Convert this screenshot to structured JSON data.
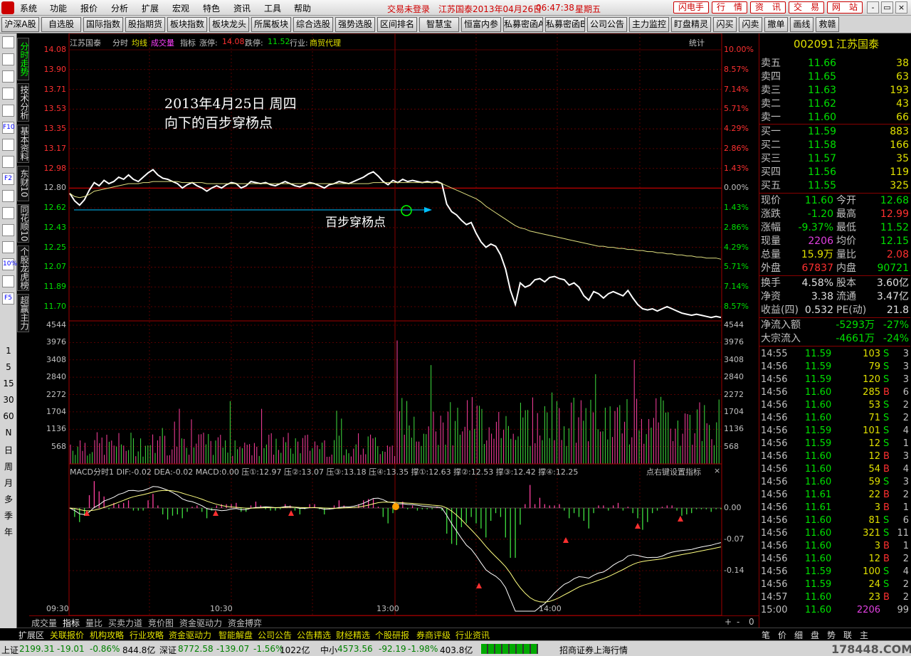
{
  "menu": {
    "items": [
      "系统",
      "功能",
      "报价",
      "分析",
      "扩展",
      "宏观",
      "特色",
      "资讯",
      "工具",
      "帮助"
    ],
    "status_login": "交易未登录",
    "status_stock": "江苏国泰2013年04月26日",
    "status_time": "06:47:38",
    "status_day": "星期五",
    "right_buttons": [
      "闪电手",
      "行　情",
      "资　讯",
      "交　易",
      "网　站"
    ],
    "window_buttons": [
      "-",
      "▭",
      "×"
    ]
  },
  "toolbar": {
    "items": [
      "沪深A股",
      "自选股",
      "国际指数",
      "股指期货",
      "板块指数",
      "板块龙头",
      "所属板块",
      "综合选股",
      "强势选股",
      "区间排名",
      "智慧宝",
      "恒富内参",
      "私募密函A",
      "私募密函B",
      "公司公告",
      "主力监控",
      "盯盘精灵",
      "闪买",
      "闪卖",
      "撤单",
      "画线",
      "救赣"
    ]
  },
  "sidebar": {
    "icons": [
      "list-icon",
      "grid-icon",
      "line-chart-icon",
      "candle-icon",
      "table-icon",
      "f10-icon",
      "report-icon",
      "news-icon",
      "f2-icon",
      "block-icon",
      "search-icon",
      "trend-icon",
      "bar-icon",
      "percent-icon",
      "pen-icon",
      "f5-icon"
    ],
    "icon_labels": [
      "",
      "",
      "",
      "",
      "",
      "F10",
      "",
      "",
      "F2",
      "",
      "",
      "",
      "",
      "10%",
      "",
      "F5"
    ],
    "periods": [
      "1",
      "5",
      "15",
      "30",
      "60",
      "N",
      "日",
      "周",
      "月",
      "多",
      "季",
      "年"
    ]
  },
  "vtabs": [
    "分时走势",
    "技术分析",
    "基本资料",
    "东财10",
    "同花顺10",
    "个股龙虎榜",
    "超赢主力"
  ],
  "chart_header": {
    "name": "江苏国泰",
    "mode": "分时",
    "avg": "均线",
    "vol": "成交量",
    "ind": "指标",
    "limit_up_label": "涨停:",
    "limit_up": "14.08",
    "limit_down_label": "跌停:",
    "limit_down": "11.52",
    "industry_label": "行业:",
    "industry": "商贸代理",
    "stats": "统计"
  },
  "annotations": {
    "date_line": "2013年4月25日  周四",
    "desc_line": "向下的百步穿杨点",
    "point_label": "百步穿杨点"
  },
  "macd_header": "MACD分时1  DIF:-0.02  DEA:-0.02  MACD:0.00  压①:12.97  压②:13.07  压③:13.18  压④:13.35  撑①:12.63  撑②:12.53  撑③:12.42  撑④:12.25",
  "macd_hint": "点右键设置指标",
  "chart_data": {
    "type": "line",
    "price_axis": {
      "labels": [
        "14.08",
        "13.90",
        "13.71",
        "13.53",
        "13.35",
        "13.17",
        "12.98",
        "12.80",
        "12.62",
        "12.43",
        "12.25",
        "12.07",
        "11.89",
        "11.70"
      ],
      "ylim": [
        11.7,
        14.08
      ],
      "prev_close": 12.8
    },
    "pct_axis": {
      "labels": [
        "10.00%",
        "8.57%",
        "7.14%",
        "5.71%",
        "4.29%",
        "2.86%",
        "1.43%",
        "0.00%",
        "1.43%",
        "2.86%",
        "4.29%",
        "5.71%",
        "7.14%",
        "8.57%"
      ]
    },
    "volume_axis": {
      "labels": [
        "4544",
        "3976",
        "3408",
        "2840",
        "2272",
        "1704",
        "1136",
        "568"
      ],
      "ylim": [
        0,
        4544
      ]
    },
    "macd_axis": {
      "labels": [
        "0.00",
        "-0.07",
        "-0.14"
      ],
      "ylim": [
        -0.21,
        0.07
      ]
    },
    "time_labels": [
      "09:30",
      "10:30",
      "13:00",
      "14:00"
    ],
    "series": [
      {
        "values": [
          12.75,
          12.68,
          12.64,
          12.69,
          12.78,
          12.85,
          12.82,
          12.87,
          12.84,
          12.86,
          12.9,
          12.88,
          12.92,
          12.88,
          12.86,
          12.9,
          12.94,
          12.97,
          12.92,
          12.89,
          12.88,
          12.86,
          12.84,
          12.8,
          12.83,
          12.85,
          12.82,
          12.8,
          12.77,
          12.8,
          12.82,
          12.8,
          12.83,
          12.85,
          12.84,
          12.8,
          12.82,
          12.86,
          12.85,
          12.84,
          12.85,
          12.83,
          12.82,
          12.84,
          12.86,
          12.84,
          12.82,
          12.81,
          12.83,
          12.85,
          12.84,
          12.82,
          12.8,
          12.83,
          12.84,
          12.86,
          12.85,
          12.84,
          12.86,
          12.88,
          12.9,
          12.93,
          12.95,
          12.91,
          12.86,
          12.83,
          12.87,
          12.85,
          12.88,
          12.86,
          12.87,
          12.86,
          12.85,
          12.86,
          12.85,
          12.86,
          12.84,
          12.65,
          12.58,
          12.55,
          12.5,
          12.46,
          12.48,
          12.38,
          12.3,
          12.25,
          12.28,
          12.26,
          12.18,
          12.05,
          11.85,
          11.72,
          11.92,
          11.88,
          11.9,
          11.95,
          11.96,
          11.93,
          11.97,
          11.98,
          11.96,
          11.95,
          11.9,
          11.92,
          11.88,
          11.8,
          11.76,
          11.84,
          11.82,
          11.78,
          11.82,
          11.84,
          11.82,
          11.8,
          11.85,
          11.78,
          11.72,
          11.68,
          11.67,
          11.68,
          11.66,
          11.68,
          11.7,
          11.68,
          11.66,
          11.64,
          11.63,
          11.62,
          11.63,
          11.62,
          11.61,
          11.6,
          11.61,
          11.6
        ]
      },
      {
        "values": [
          12.75,
          12.72,
          12.71,
          12.72,
          12.74,
          12.77,
          12.78,
          12.79,
          12.8,
          12.81,
          12.82,
          12.83,
          12.84,
          12.84,
          12.84,
          12.85,
          12.85,
          12.86,
          12.86,
          12.86,
          12.86,
          12.86,
          12.86,
          12.85,
          12.85,
          12.85,
          12.85,
          12.85,
          12.84,
          12.84,
          12.84,
          12.84,
          12.84,
          12.84,
          12.84,
          12.84,
          12.84,
          12.84,
          12.84,
          12.84,
          12.84,
          12.84,
          12.84,
          12.84,
          12.84,
          12.84,
          12.84,
          12.84,
          12.84,
          12.84,
          12.84,
          12.84,
          12.84,
          12.84,
          12.84,
          12.84,
          12.84,
          12.84,
          12.84,
          12.84,
          12.84,
          12.84,
          12.85,
          12.85,
          12.85,
          12.85,
          12.85,
          12.85,
          12.85,
          12.85,
          12.85,
          12.85,
          12.85,
          12.85,
          12.85,
          12.85,
          12.84,
          12.82,
          12.8,
          12.78,
          12.76,
          12.74,
          12.72,
          12.7,
          12.67,
          12.63,
          12.6,
          12.57,
          12.54,
          12.51,
          12.48,
          12.45,
          12.43,
          12.42,
          12.4,
          12.39,
          12.38,
          12.37,
          12.36,
          12.35,
          12.34,
          12.33,
          12.32,
          12.31,
          12.3,
          12.29,
          12.28,
          12.27,
          12.26,
          12.26,
          12.25,
          12.25,
          12.24,
          12.24,
          12.23,
          12.23,
          12.22,
          12.22,
          12.21,
          12.21,
          12.2,
          12.2,
          12.19,
          12.19,
          12.18,
          12.18,
          12.17,
          12.17,
          12.16,
          12.16,
          12.15,
          12.15,
          12.15,
          12.14
        ]
      }
    ]
  },
  "quote": {
    "code": "002091",
    "name": "江苏国泰",
    "sell": [
      {
        "label": "卖五",
        "price": "11.66",
        "vol": "38"
      },
      {
        "label": "卖四",
        "price": "11.65",
        "vol": "63"
      },
      {
        "label": "卖三",
        "price": "11.63",
        "vol": "193"
      },
      {
        "label": "卖二",
        "price": "11.62",
        "vol": "43"
      },
      {
        "label": "卖一",
        "price": "11.60",
        "vol": "66"
      }
    ],
    "buy": [
      {
        "label": "买一",
        "price": "11.59",
        "vol": "883"
      },
      {
        "label": "买二",
        "price": "11.58",
        "vol": "166"
      },
      {
        "label": "买三",
        "price": "11.57",
        "vol": "35"
      },
      {
        "label": "买四",
        "price": "11.56",
        "vol": "119"
      },
      {
        "label": "买五",
        "price": "11.55",
        "vol": "325"
      }
    ],
    "stats": [
      {
        "l1": "现价",
        "v1": "11.60",
        "c1": "#00e000",
        "l2": "今开",
        "v2": "12.68",
        "c2": "#00e000"
      },
      {
        "l1": "涨跌",
        "v1": "-1.20",
        "c1": "#00e000",
        "l2": "最高",
        "v2": "12.99",
        "c2": "#ff3030"
      },
      {
        "l1": "涨幅",
        "v1": "-9.37%",
        "c1": "#00e000",
        "l2": "最低",
        "v2": "11.52",
        "c2": "#00e000"
      },
      {
        "l1": "现量",
        "v1": "2206",
        "c1": "#e040e0",
        "l2": "均价",
        "v2": "12.15",
        "c2": "#00e000"
      },
      {
        "l1": "总量",
        "v1": "15.9万",
        "c1": "#e0e000",
        "l2": "量比",
        "v2": "2.08",
        "c2": "#ff3030"
      },
      {
        "l1": "外盘",
        "v1": "67837",
        "c1": "#ff3030",
        "l2": "内盘",
        "v2": "90721",
        "c2": "#00e000"
      }
    ],
    "fund": [
      {
        "l1": "换手",
        "v1": "4.58%",
        "l2": "股本",
        "v2": "3.60亿"
      },
      {
        "l1": "净资",
        "v1": "3.38",
        "l2": "流通",
        "v2": "3.47亿"
      },
      {
        "l1": "收益(四)",
        "v1": "0.532",
        "l2": "PE(动)",
        "v2": "21.8"
      }
    ],
    "flow": [
      {
        "l": "净流入额",
        "v": "-5293万",
        "p": "-27%"
      },
      {
        "l": "大宗流入",
        "v": "-4661万",
        "p": "-24%"
      }
    ],
    "ticks": [
      [
        "14:55",
        "11.59",
        "103",
        "S",
        "3"
      ],
      [
        "14:56",
        "11.59",
        "79",
        "S",
        "3"
      ],
      [
        "14:56",
        "11.59",
        "120",
        "S",
        "3"
      ],
      [
        "14:56",
        "11.60",
        "285",
        "B",
        "6"
      ],
      [
        "14:56",
        "11.60",
        "53",
        "S",
        "2"
      ],
      [
        "14:56",
        "11.60",
        "71",
        "S",
        "2"
      ],
      [
        "14:56",
        "11.59",
        "101",
        "S",
        "4"
      ],
      [
        "14:56",
        "11.59",
        "12",
        "S",
        "1"
      ],
      [
        "14:56",
        "11.60",
        "12",
        "B",
        "3"
      ],
      [
        "14:56",
        "11.60",
        "54",
        "B",
        "4"
      ],
      [
        "14:56",
        "11.60",
        "59",
        "S",
        "3"
      ],
      [
        "14:56",
        "11.61",
        "22",
        "B",
        "2"
      ],
      [
        "14:56",
        "11.61",
        "3",
        "B",
        "1"
      ],
      [
        "14:56",
        "11.60",
        "81",
        "S",
        "6"
      ],
      [
        "14:56",
        "11.60",
        "321",
        "S",
        "11"
      ],
      [
        "14:56",
        "11.60",
        "3",
        "B",
        "1"
      ],
      [
        "14:56",
        "11.60",
        "12",
        "B",
        "2"
      ],
      [
        "14:56",
        "11.59",
        "100",
        "S",
        "4"
      ],
      [
        "14:56",
        "11.59",
        "24",
        "S",
        "2"
      ],
      [
        "14:57",
        "11.60",
        "23",
        "B",
        "2"
      ],
      [
        "15:00",
        "11.60",
        "2206",
        "",
        "99"
      ]
    ]
  },
  "bottom_tabs": [
    "成交量",
    "指标",
    "量比",
    "买卖力道",
    "竞价图",
    "资金驱动力",
    "资金搏弈"
  ],
  "bottom_ctrl": [
    "+",
    "-",
    "0"
  ],
  "link_bar": [
    "扩展区",
    "关联报价",
    "机构攻略",
    "行业攻略",
    "资金驱动力",
    "智能解盘",
    "公司公告",
    "公告精选",
    "财经精选",
    "个股研报",
    "券商评级",
    "行业资讯"
  ],
  "right_tabs": [
    "笔",
    "价",
    "细",
    "盘",
    "势",
    "联",
    "主"
  ],
  "statusbar": {
    "sh_label": "上证",
    "sh_val": "2199.31",
    "sh_chg": "-19.01",
    "sh_pct": "-0.86%",
    "sh_amt": "844.8亿",
    "sz_label": "深证",
    "sz_val": "8772.58",
    "sz_chg": "-139.07",
    "sz_pct": "-1.56%",
    "sz_amt": "1022亿",
    "zx_label": "中小",
    "zx_val": "4573.56",
    "zx_chg": "-92.19",
    "zx_pct": "-1.98%",
    "zx_amt": "403.8亿",
    "broker": "招商证券上海行情",
    "watermark": "178448.COM"
  }
}
